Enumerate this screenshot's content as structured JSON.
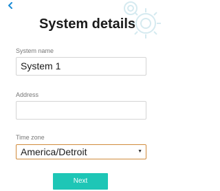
{
  "header": {
    "back_icon": "chevron-left-icon",
    "title": "System details",
    "watermark_icon": "gear-icon"
  },
  "form": {
    "system_name": {
      "label": "System name",
      "value": "System 1"
    },
    "address": {
      "label": "Address",
      "value": ""
    },
    "time_zone": {
      "label": "Time zone",
      "selected": "America/Detroit"
    }
  },
  "actions": {
    "next_label": "Next"
  },
  "colors": {
    "accent": "#1ec6b6",
    "back_icon": "#1a8bd6",
    "select_focus_border": "#d08a3a"
  }
}
